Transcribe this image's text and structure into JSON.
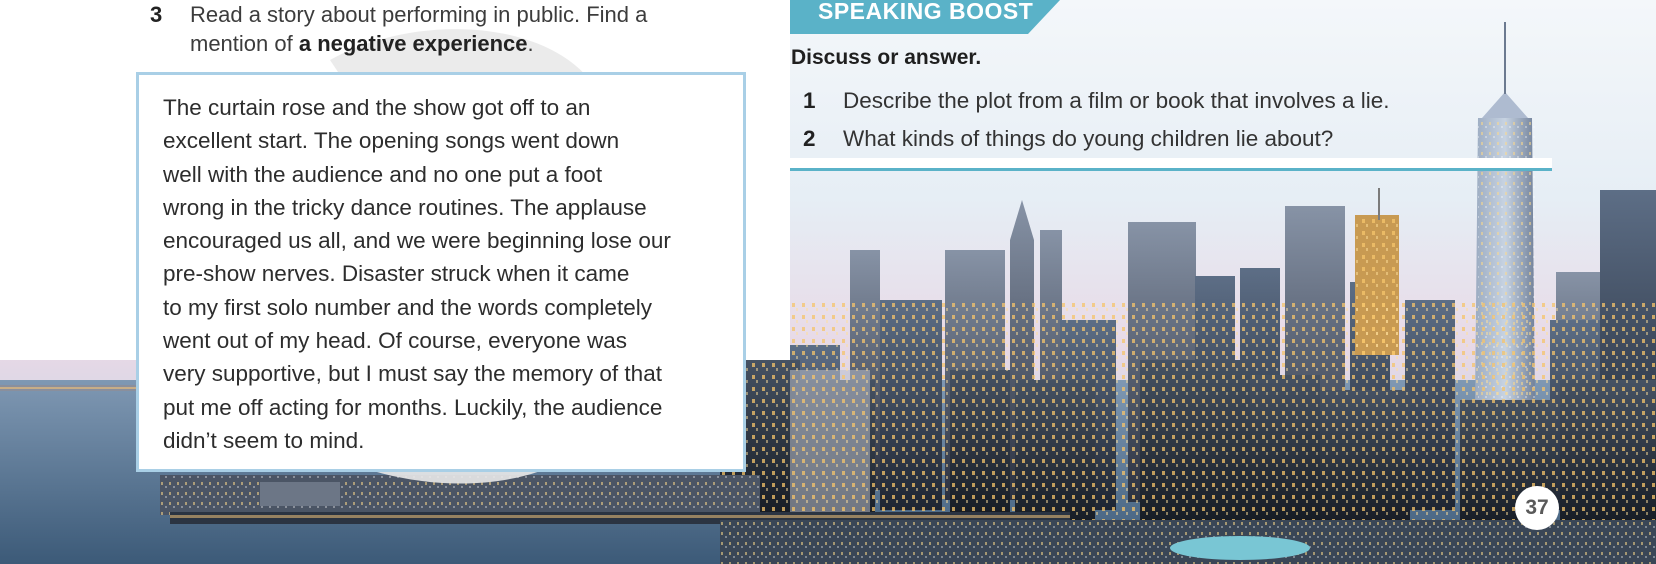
{
  "exercise": {
    "number": "3",
    "text_before": "Read a story about performing in public. Find a mention of ",
    "highlight": "a negative experience",
    "text_after": "."
  },
  "story": {
    "text": "The curtain rose and the show got off to an\nexcellent start. The opening songs went down\nwell with the audience and no one put a foot\nwrong in the tricky dance routines. The applause\nencouraged us all, and we were beginning lose our\npre-show nerves. Disaster struck when it came\nto my first solo number and the words completely\nwent out of my head. Of course, everyone was\nvery supportive, but I must say the memory of that\nput me off acting for months. Luckily, the audience\ndidn’t seem to mind."
  },
  "speaking_boost": {
    "label": "SPEAKING BOOST",
    "instruction": "Discuss or answer.",
    "questions": [
      {
        "number": "1",
        "text": "Describe the plot from a film or book that involves a lie."
      },
      {
        "number": "2",
        "text": "What kinds of things do young children lie about?"
      }
    ]
  },
  "page_number": "37",
  "colors": {
    "banner": "#5ab2c8",
    "box_border": "#a9cfe6",
    "rule": "#5ab2c8"
  },
  "image": {
    "description_icon": "city-skyline-photo"
  }
}
